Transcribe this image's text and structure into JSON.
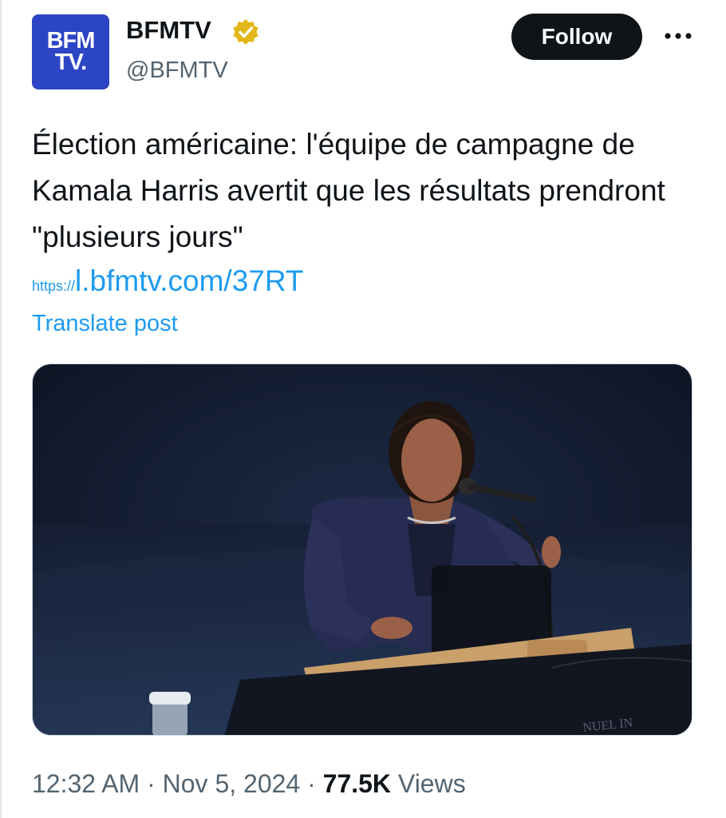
{
  "author": {
    "avatar_text_line1": "BFM",
    "avatar_text_line2": "TV.",
    "name": "BFMTV",
    "handle": "@BFMTV",
    "verified_badge_color": "#e2b719",
    "avatar_color": "#2b45c4"
  },
  "follow_label": "Follow",
  "more_icon": "more-horizontal-icon",
  "post": {
    "text": "Élection américaine: l'équipe de campagne de Kamala Harris avertit que les résultats prendront \"plusieurs jours\"",
    "link_scheme": "https://",
    "link_body": "l.bfmtv.com/37RT",
    "translate_label": "Translate post"
  },
  "media": {
    "podium_partial_text": "NUEL IN"
  },
  "meta": {
    "time": "12:32 AM",
    "separator": " · ",
    "date": "Nov 5, 2024",
    "views_count": "77.5K",
    "views_label": "Views"
  },
  "colors": {
    "link": "#1d9bf0",
    "secondary_text": "#536471",
    "primary_text": "#0f1419"
  }
}
